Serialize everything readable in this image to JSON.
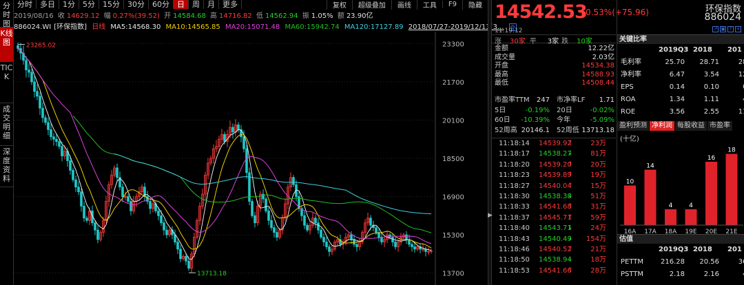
{
  "left_tabs": [
    {
      "label": "分时图",
      "active": false
    },
    {
      "label": "K线图",
      "active": true
    },
    {
      "label": "TICK",
      "active": false
    },
    {
      "label": "成交明细",
      "active": false
    },
    {
      "label": "深度资料",
      "active": false
    }
  ],
  "periods": [
    {
      "label": "分时",
      "active": false
    },
    {
      "label": "多日",
      "active": false
    },
    {
      "label": "1分",
      "active": false
    },
    {
      "label": "5分",
      "active": false
    },
    {
      "label": "15分",
      "active": false
    },
    {
      "label": "30分",
      "active": false
    },
    {
      "label": "60分",
      "active": false
    },
    {
      "label": "日",
      "active": true
    },
    {
      "label": "周",
      "active": false
    },
    {
      "label": "月",
      "active": false
    },
    {
      "label": "更多",
      "active": false
    }
  ],
  "right_toolbar": [
    "复权",
    "超级叠加",
    "画线",
    "工具",
    "F9",
    "隐藏"
  ],
  "quote_line": {
    "date": "2019/08/16",
    "close_label": "收",
    "close": "14629.12",
    "range_label": "幅",
    "range": "0.27%(39.52)",
    "open_label": "开",
    "open": "14584.68",
    "high_label": "高",
    "high": "14716.82",
    "low_label": "低",
    "low": "14562.94",
    "amp_label": "振",
    "amp": "1.05%",
    "amt_label": "额",
    "amt": "23.90亿"
  },
  "ma_line": {
    "code": "886024.WI",
    "name": "[环保指数]",
    "kline": "日线",
    "ma5": "MA5:14568.30",
    "ma10": "MA10:14565.85",
    "ma20": "MA20:15071.48",
    "ma60": "MA60:15942.74",
    "ma120": "MA120:17127.89",
    "range": "2018/07/27-2019/12/13(3..."
  },
  "colors": {
    "up": "#ff3b3b",
    "down": "#22d322",
    "ma5": "#e8e8e8",
    "ma10": "#f0d000",
    "ma20": "#e040e0",
    "ma60": "#22c022",
    "ma120": "#40d0e0",
    "accent": "#d22"
  },
  "chart_data": {
    "type": "candlestick",
    "ylim": [
      13200,
      23800
    ],
    "y_ticks": [
      "23300",
      "21700",
      "20100",
      "18500",
      "16900",
      "15300",
      "13700"
    ],
    "tick_values": [
      23300,
      21700,
      20100,
      18500,
      16900,
      15300,
      13700
    ],
    "annotations": [
      {
        "label": "23265.02",
        "value": 23265.02,
        "index": 0
      },
      {
        "label": "13713.18",
        "value": 13713.18,
        "index": 62
      }
    ],
    "closes": [
      23100,
      22900,
      22600,
      22200,
      22100,
      21700,
      21300,
      21100,
      20600,
      20200,
      20000,
      19700,
      19400,
      19300,
      19200,
      19000,
      18600,
      18800,
      18400,
      18000,
      17600,
      17300,
      17100,
      16500,
      16000,
      15900,
      16300,
      15800,
      15500,
      15100,
      15400,
      15900,
      16700,
      17400,
      17800,
      18100,
      17700,
      17300,
      16900,
      16900,
      16700,
      16300,
      16700,
      16900,
      17100,
      17300,
      16900,
      16700,
      16400,
      16600,
      16300,
      16100,
      15800,
      15500,
      15300,
      15500,
      15300,
      15000,
      14700,
      14300,
      14400,
      14200,
      13900,
      14500,
      15200,
      15900,
      16500,
      17000,
      17800,
      18300,
      18500,
      18900,
      19000,
      19300,
      19500,
      19200,
      19500,
      19800,
      19600,
      19900,
      19700,
      19400,
      18900,
      17900,
      16700,
      16100,
      15800,
      16500,
      17000,
      16800,
      16300,
      15900,
      15600,
      15400,
      15200,
      15500,
      16000,
      16600,
      17300,
      17700,
      17400,
      16900,
      16400,
      16100,
      15700,
      15500,
      15700,
      16000,
      15800,
      15500,
      15200,
      15000,
      14800,
      14600,
      14700,
      15000,
      15100,
      14900,
      15000,
      15200,
      15300,
      15100,
      14900,
      14800,
      15000,
      15400,
      15800,
      16000,
      15700,
      15600,
      15400,
      15200,
      15000,
      15100,
      15300,
      15200,
      15000,
      14800,
      15000,
      15200,
      15300,
      15100,
      14900,
      14800,
      14700,
      14800,
      14700,
      14700,
      14600,
      14600,
      14629
    ]
  },
  "right_panel": {
    "price": "14542.53",
    "change": "+0.53%",
    "change_abs": "(+75.96)",
    "time": "11:19:12",
    "breadth": {
      "up_label": "涨",
      "up": "30家",
      "flat_label": "平",
      "flat": "3家",
      "down_label": "跌",
      "down": "10家"
    },
    "stats": [
      {
        "k": "金额",
        "v": "12.22亿",
        "c": "wh"
      },
      {
        "k": "成交量",
        "v": "2.03亿",
        "c": "wh"
      },
      {
        "k": "开盘",
        "v": "14534.38",
        "c": "up"
      },
      {
        "k": "最高",
        "v": "14588.93",
        "c": "up"
      },
      {
        "k": "最低",
        "v": "14508.44",
        "c": "up"
      }
    ],
    "valuation": [
      {
        "k1": "市盈率TTM",
        "v1": "247",
        "k2": "市净率LF",
        "v2": "1.71"
      },
      {
        "k1": "5日",
        "v1": "-0.19%",
        "k2": "20日",
        "v2": "-0.02%"
      },
      {
        "k1": "60日",
        "v1": "-10.39%",
        "k2": "今年",
        "v2": "-5.09%"
      },
      {
        "k1": "52周高",
        "v1": "20146.1",
        "k2": "52周低",
        "v2": "13713.18"
      }
    ],
    "ticks": [
      {
        "t": "11:18:14",
        "p": "14539.92",
        "d": "up",
        "q": "23万"
      },
      {
        "t": "11:18:17",
        "p": "14538.27",
        "d": "dn",
        "q": "81万"
      },
      {
        "t": "11:18:20",
        "p": "14539.20",
        "d": "up",
        "q": "20万"
      },
      {
        "t": "11:18:23",
        "p": "14539.89",
        "d": "up",
        "q": "19万"
      },
      {
        "t": "11:18:27",
        "p": "14540.04",
        "d": "up",
        "q": "15万"
      },
      {
        "t": "11:18:30",
        "p": "14538.38",
        "d": "dn",
        "q": "51万"
      },
      {
        "t": "11:18:33",
        "p": "14541.68",
        "d": "up",
        "q": "31万"
      },
      {
        "t": "11:18:37",
        "p": "14545.71",
        "d": "up",
        "q": "59万"
      },
      {
        "t": "11:18:40",
        "p": "14543.71",
        "d": "dn",
        "q": "24万"
      },
      {
        "t": "11:18:43",
        "p": "14540.49",
        "d": "dn",
        "q": "154万"
      },
      {
        "t": "11:18:46",
        "p": "14540.52",
        "d": "up",
        "q": "21万"
      },
      {
        "t": "11:18:50",
        "p": "14538.94",
        "d": "dn",
        "q": "18万"
      },
      {
        "t": "11:18:53",
        "p": "14541.66",
        "d": "up",
        "q": "28万"
      }
    ]
  },
  "fin_panel": {
    "name": "环保指数",
    "code": "886024",
    "icons": [
      "↗",
      "▣",
      "?",
      "+"
    ],
    "key_title": "关键比率",
    "cols": [
      "2019Q3",
      "2018",
      "201"
    ],
    "rows": [
      {
        "k": "毛利率",
        "v": [
          "25.70",
          "28.71",
          "28.7"
        ]
      },
      {
        "k": "净利率",
        "v": [
          "6.47",
          "3.54",
          "12.4"
        ]
      },
      {
        "k": "EPS",
        "v": [
          "0.14",
          "0.10",
          "0.4"
        ]
      },
      {
        "k": "ROA",
        "v": [
          "1.34",
          "1.11",
          "4.9"
        ]
      },
      {
        "k": "ROE",
        "v": [
          "3.56",
          "2.55",
          "11.5"
        ]
      }
    ],
    "tabs": [
      {
        "label": "盈利预测",
        "active": false
      },
      {
        "label": "净利润",
        "active": true
      },
      {
        "label": "每股收益",
        "active": false
      },
      {
        "label": "市盈率",
        "active": false
      }
    ],
    "unit": "(十亿)",
    "bars": {
      "categories": [
        "16A",
        "17A",
        "18A",
        "19E",
        "20E",
        "21E"
      ],
      "values": [
        10,
        14,
        4,
        4,
        16,
        18
      ]
    },
    "val_title": "估值",
    "val_cols": [
      "2019Q3",
      "2018",
      "201"
    ],
    "val_rows": [
      {
        "k": "PETTM",
        "v": [
          "216.28",
          "20.56",
          "36.9"
        ]
      },
      {
        "k": "PSTTM",
        "v": [
          "2.18",
          "2.16",
          "4.9"
        ]
      }
    ]
  }
}
